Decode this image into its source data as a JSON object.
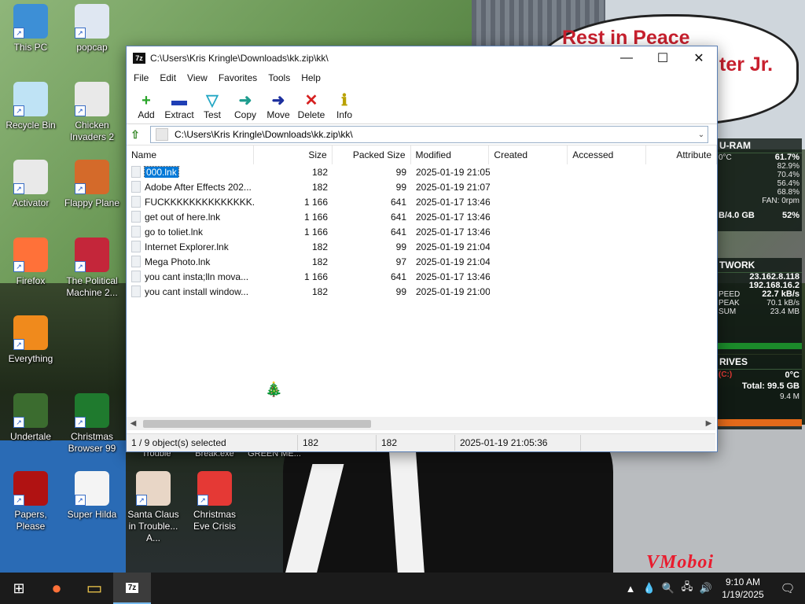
{
  "desktop": {
    "bubble_line1": "Rest in Peace",
    "bubble_line2": "ter Jr.",
    "watermark": "VMoboi",
    "icons": [
      {
        "label": "This PC",
        "color": "#3d8fd6"
      },
      {
        "label": "popcap",
        "color": "#dfe7f2"
      },
      {
        "label": "Recycle Bin",
        "color": "#bfe3f5"
      },
      {
        "label": "Chicken Invaders 2",
        "color": "#e9e9e9"
      },
      {
        "label": "Activator",
        "color": "#e9e9e9"
      },
      {
        "label": "Flappy Plane",
        "color": "#d46a2a"
      },
      {
        "label": "Firefox",
        "color": "#ff7139"
      },
      {
        "label": "The Political Machine 2...",
        "color": "#c4263a"
      },
      {
        "label": "Everything",
        "color": "#f08a1c"
      },
      {
        "label": "Undertale",
        "color": "#3b6c2f"
      },
      {
        "label": "Christmas Browser 99",
        "color": "#1f7a2e"
      },
      {
        "label": "Papers, Please",
        "color": "#b01212"
      },
      {
        "label": "Super Hilda",
        "color": "#f4f4f4"
      },
      {
        "label": "Santa Claus in Trouble... A...",
        "color": "#e8d6c6"
      },
      {
        "label": "Christmas Eve Crisis",
        "color": "#e53935"
      }
    ],
    "partial_labels": [
      "Trouble",
      "Break.exe",
      "GREEN ME..."
    ]
  },
  "window": {
    "title": "C:\\Users\\Kris Kringle\\Downloads\\kk.zip\\kk\\",
    "app_icon": "7z",
    "minimize": "—",
    "maximize": "☐",
    "close": "✕",
    "menu": [
      "File",
      "Edit",
      "View",
      "Favorites",
      "Tools",
      "Help"
    ],
    "toolbar": [
      {
        "label": "Add",
        "glyph": "+",
        "color": "#2aa52a"
      },
      {
        "label": "Extract",
        "glyph": "▬",
        "color": "#1f3fb5"
      },
      {
        "label": "Test",
        "glyph": "▽",
        "color": "#23a7c4"
      },
      {
        "label": "Copy",
        "glyph": "➜",
        "color": "#1e9c8e"
      },
      {
        "label": "Move",
        "glyph": "➜",
        "color": "#1c2f9e"
      },
      {
        "label": "Delete",
        "glyph": "✕",
        "color": "#d62020"
      },
      {
        "label": "Info",
        "glyph": "ℹ",
        "color": "#b9a100"
      }
    ],
    "address": "C:\\Users\\Kris Kringle\\Downloads\\kk.zip\\kk\\",
    "columns": [
      "Name",
      "Size",
      "Packed Size",
      "Modified",
      "Created",
      "Accessed",
      "Attribute"
    ],
    "files": [
      {
        "name": "000.lnk",
        "size": "182",
        "packed": "99",
        "modified": "2025-01-19 21:05",
        "selected": true
      },
      {
        "name": "Adobe After Effects 202...",
        "size": "182",
        "packed": "99",
        "modified": "2025-01-19 21:07"
      },
      {
        "name": "FUCKKKKKKKKKKKKKK...",
        "size": "1 166",
        "packed": "641",
        "modified": "2025-01-17 13:46"
      },
      {
        "name": "get out of here.lnk",
        "size": "1 166",
        "packed": "641",
        "modified": "2025-01-17 13:46"
      },
      {
        "name": "go to toliet.lnk",
        "size": "1 166",
        "packed": "641",
        "modified": "2025-01-17 13:46"
      },
      {
        "name": "Internet Explorer.lnk",
        "size": "182",
        "packed": "99",
        "modified": "2025-01-19 21:04"
      },
      {
        "name": "Mega Photo.lnk",
        "size": "182",
        "packed": "97",
        "modified": "2025-01-19 21:04"
      },
      {
        "name": "you cant insta;lln mova...",
        "size": "1 166",
        "packed": "641",
        "modified": "2025-01-17 13:46"
      },
      {
        "name": "you cant install window...",
        "size": "182",
        "packed": "99",
        "modified": "2025-01-19 21:00"
      }
    ],
    "status": {
      "selection": "1 / 9 object(s) selected",
      "size": "182",
      "packed": "182",
      "modified": "2025-01-19 21:05:36"
    }
  },
  "monitor": {
    "ram": {
      "header": "U-RAM",
      "temp": "0°C",
      "total_pct": "61.7%",
      "cores": [
        "82.9%",
        "70.4%",
        "56.4%",
        "68.8%"
      ],
      "fan": "FAN: 0rpm",
      "mem": "B/4.0 GB",
      "mem_pct": "52%"
    },
    "network": {
      "header": "TWORK",
      "ip1": "23.162.8.118",
      "ip2": "192.168.16.2",
      "speed_label": "PEED",
      "speed": "22.7 kB/s",
      "peak_label": "PEAK",
      "peak": "70.1 kB/s",
      "sum_label": "SUM",
      "sum": "23.4 MB"
    },
    "drives": {
      "header": "RIVES",
      "drive": "(C:)",
      "temp": "0°C",
      "total": "Total: 99.5 GB",
      "rate": "9.4 M"
    }
  },
  "taskbar": {
    "start": "⊞",
    "firefox": "●",
    "explorer": "▭",
    "zip": "7z",
    "tray": [
      "▲",
      "💧",
      "🔍",
      "🖧",
      "🔊"
    ],
    "time": "9:10 AM",
    "date": "1/19/2025",
    "notifications": "🗨"
  }
}
